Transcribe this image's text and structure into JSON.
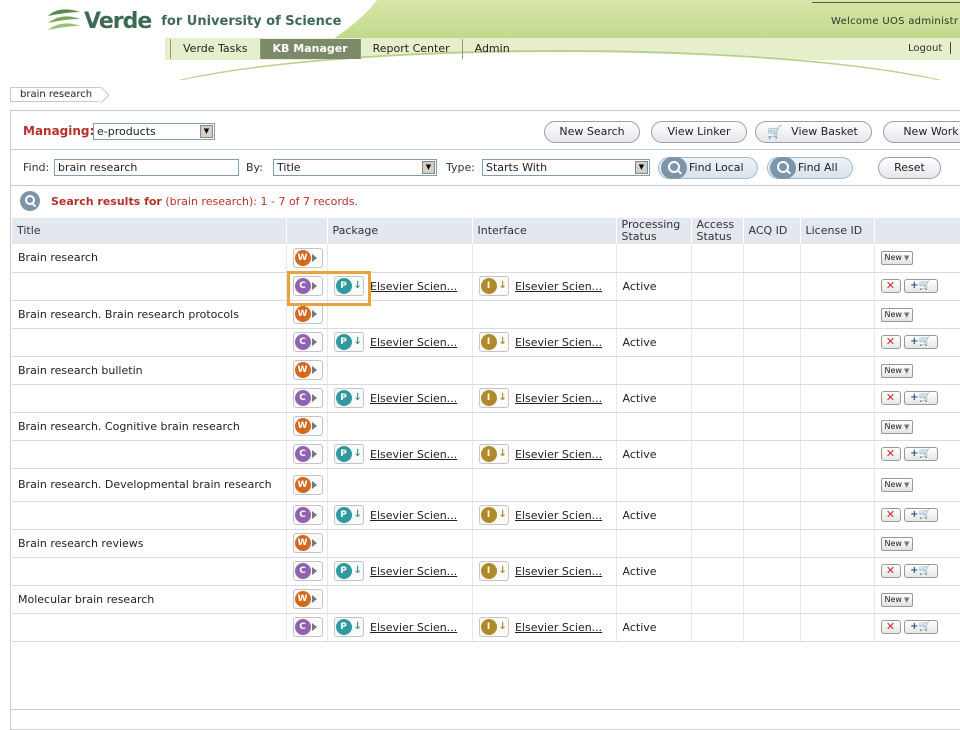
{
  "header": {
    "logo_word": "Verde",
    "logo_subtitle": "for University of Science",
    "welcome_text": "Welcome UOS administr",
    "logout_label": "Logout",
    "nav_tabs": [
      {
        "label": "Verde Tasks",
        "active": false
      },
      {
        "label": "KB Manager",
        "active": true
      },
      {
        "label": "Report Center",
        "active": false
      },
      {
        "label": "Admin",
        "active": false
      }
    ]
  },
  "breadcrumb": {
    "label": "brain research"
  },
  "toolbar": {
    "managing_label": "Managing:",
    "managing_value": "e-products",
    "new_search_label": "New Search",
    "view_linker_label": "View Linker",
    "view_basket_label": "View Basket",
    "new_work_label": "New Work"
  },
  "search": {
    "find_label": "Find:",
    "find_value": "brain research",
    "by_label": "By:",
    "by_value": "Title",
    "type_label": "Type:",
    "type_value": "Starts With",
    "find_local_label": "Find Local",
    "find_all_label": "Find All",
    "reset_label": "Reset"
  },
  "results": {
    "lead": "Search results for",
    "detail": " (brain research): 1 - 7  of 7 records."
  },
  "table": {
    "columns": {
      "title": "Title",
      "package": "Package",
      "interface": "Interface",
      "processing_status": "Processing Status",
      "access_status": "Access Status",
      "acq_id": "ACQ ID",
      "license_id": "License ID"
    },
    "new_label": "New",
    "records": [
      {
        "title": "Brain research",
        "package": "Elsevier Scien...",
        "interface": "Elsevier Scien...",
        "status": "Active"
      },
      {
        "title": "Brain research. Brain research protocols",
        "package": "Elsevier Scien...",
        "interface": "Elsevier Scien...",
        "status": "Active"
      },
      {
        "title": "Brain research bulletin",
        "package": "Elsevier Scien...",
        "interface": "Elsevier Scien...",
        "status": "Active"
      },
      {
        "title": "Brain research. Cognitive brain research",
        "package": "Elsevier Scien...",
        "interface": "Elsevier Scien...",
        "status": "Active"
      },
      {
        "title": "Brain research. Developmental brain research",
        "package": "Elsevier Scien...",
        "interface": "Elsevier Scien...",
        "status": "Active"
      },
      {
        "title": "Brain research reviews",
        "package": "Elsevier Scien...",
        "interface": "Elsevier Scien...",
        "status": "Active"
      },
      {
        "title": "Molecular brain research",
        "package": "Elsevier Scien...",
        "interface": "Elsevier Scien...",
        "status": "Active"
      }
    ]
  },
  "icons": {
    "work": "W",
    "collection": "C",
    "package": "P",
    "interface": "I"
  },
  "colors": {
    "accent_red": "#b5322a",
    "header_green": "#c2d98c",
    "active_tab": "#7d8a6a",
    "highlight_box": "#e8a33c"
  }
}
